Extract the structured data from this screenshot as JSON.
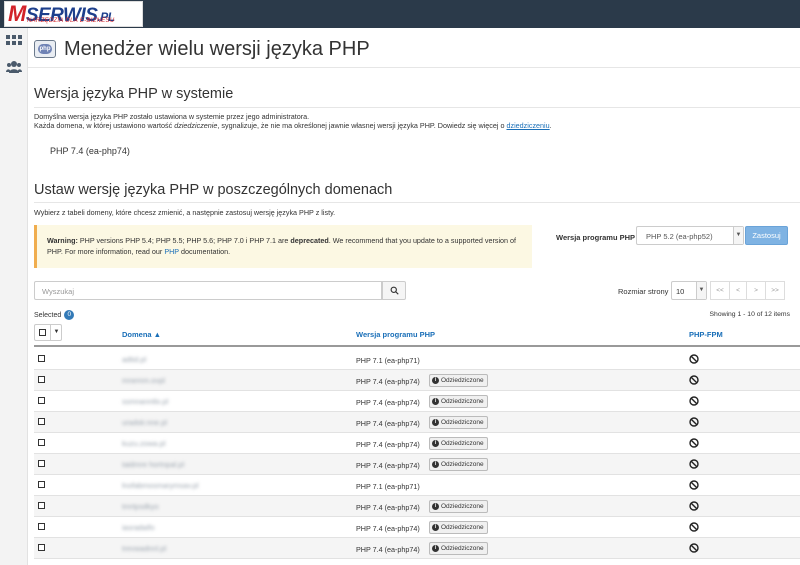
{
  "logo": {
    "brand_m": "M",
    "brand_rest": "SERWIS",
    "brand_tld": ".PL",
    "tagline": "NARZĘDZIA DLA E-BIZNESU"
  },
  "page": {
    "title": "Menedżer wielu wersji języka PHP"
  },
  "system": {
    "heading": "Wersja języka PHP w systemie",
    "desc_line1": "Domyślna wersja języka PHP zostało ustawiona w systemie przez jego administratora.",
    "desc_line2_pre": "Każda domena, w której ustawiono wartość ",
    "desc_line2_em": "dziedziczenie",
    "desc_line2_post": ", sygnalizuje, że nie ma określonej jawnie własnej wersji języka PHP. Dowiedz się więcej o ",
    "desc_link": "dziedziczeniu",
    "desc_end": ".",
    "current": "PHP 7.4 (ea-php74)"
  },
  "domains_section": {
    "heading": "Ustaw wersję języka PHP w poszczególnych domenach",
    "desc": "Wybierz z tabeli domeny, które chcesz zmienić, a następnie zastosuj wersję języka PHP z listy."
  },
  "warning": {
    "label": "Warning:",
    "text1": " PHP versions PHP 5.4; PHP 5.5; PHP 5.6; PHP 7.0 i PHP 7.1 are ",
    "deprecated": "deprecated",
    "text2": ". We recommend that you update to a supported version of PHP. For more information, read our ",
    "link": "PHP",
    "text3": " documentation."
  },
  "version_selector": {
    "label": "Wersja programu PHP",
    "selected": "PHP 5.2 (ea-php52)",
    "apply": "Zastosuj"
  },
  "search": {
    "placeholder": "Wyszukaj"
  },
  "pagination": {
    "page_size_label": "Rozmiar strony",
    "page_size": "10",
    "first": "<<",
    "prev": "<",
    "next": ">",
    "last": ">>",
    "showing": "Showing 1 - 10 of 12 items"
  },
  "selection": {
    "label": "Selected",
    "count": "0"
  },
  "table": {
    "headers": {
      "domain": "Domena ▲",
      "version": "Wersja programu PHP",
      "fpm": "PHP-FPM"
    },
    "inherited_label": "Odziedziczone",
    "rows": [
      {
        "domain": "adtid.pl",
        "version": "PHP 7.1 (ea-php71)",
        "inherited": false
      },
      {
        "domain": "mnemm.ovpl",
        "version": "PHP 7.4 (ea-php74)",
        "inherited": true
      },
      {
        "domain": "ssmnanntlo.pl",
        "version": "PHP 7.4 (ea-php74)",
        "inherited": true
      },
      {
        "domain": "uradsk:nne.pl",
        "version": "PHP 7.4 (ea-php74)",
        "inherited": true
      },
      {
        "domain": "kuzu.zowa.pl",
        "version": "PHP 7.4 (ea-php74)",
        "inherited": true
      },
      {
        "domain": "taidmre hortnpal.pl",
        "version": "PHP 7.4 (ea-php74)",
        "inherited": true
      },
      {
        "domain": "lnofabmosmarymsav.pl",
        "version": "PHP 7.1 (ea-php71)",
        "inherited": false
      },
      {
        "domain": "tmrtpsdkyo",
        "version": "PHP 7.4 (ea-php74)",
        "inherited": true
      },
      {
        "domain": "iasradaifo",
        "version": "PHP 7.4 (ea-php74)",
        "inherited": true
      },
      {
        "domain": "trevwadnnl.pl",
        "version": "PHP 7.4 (ea-php74)",
        "inherited": true
      }
    ]
  },
  "sidebar": {
    "icons": [
      "apps-grid-icon",
      "users-icon"
    ]
  },
  "colors": {
    "topbar": "#2b3a4a",
    "link": "#1a6fb8",
    "warning_bg": "#fcf8e3",
    "warning_border": "#f0ad4e",
    "apply_btn": "#7fb3e3"
  }
}
